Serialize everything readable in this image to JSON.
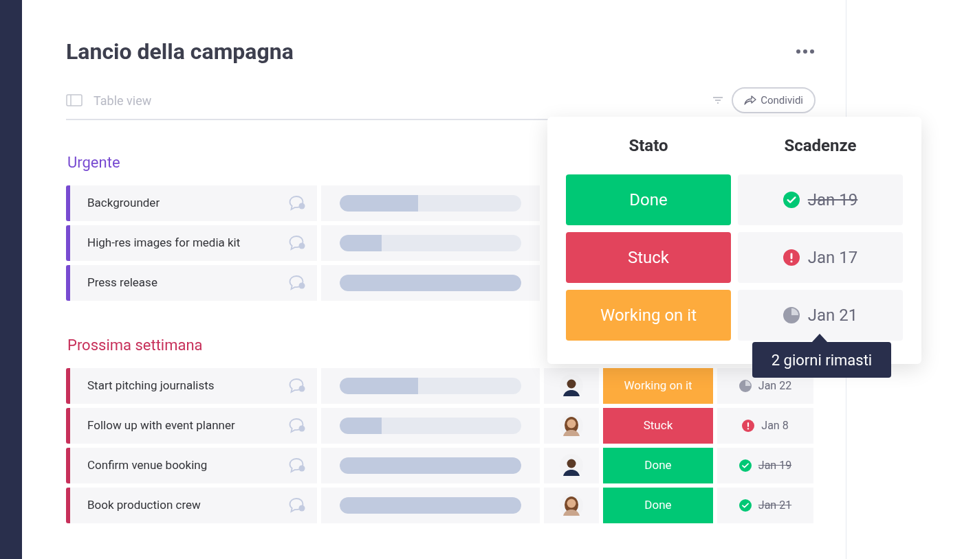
{
  "title": "Lancio della campagna",
  "view": {
    "label": "Table view"
  },
  "share_button": {
    "label": "Condividi"
  },
  "groups": [
    {
      "title": "Urgente",
      "color": "#784bd1",
      "tasks": [
        {
          "name": "Backgrounder",
          "level": 0.43
        },
        {
          "name": "High-res images for media kit",
          "level": 0.23
        },
        {
          "name": "Press release",
          "level": 1
        }
      ]
    },
    {
      "title": "Prossima settimana",
      "color": "#c7305a",
      "tasks": [
        {
          "name": "Start pitching journalists",
          "level": 0.43,
          "person": {
            "kind": "man"
          },
          "status": {
            "label": "Working on it",
            "kind": "working"
          },
          "date": {
            "label": "Jan 22",
            "kind": "working"
          }
        },
        {
          "name": "Follow up with event planner",
          "level": 0.23,
          "person": {
            "kind": "woman"
          },
          "status": {
            "label": "Stuck",
            "kind": "stuck"
          },
          "date": {
            "label": "Jan 8",
            "kind": "stuck"
          }
        },
        {
          "name": "Confirm venue booking",
          "level": 1,
          "person": {
            "kind": "man"
          },
          "status": {
            "label": "Done",
            "kind": "done"
          },
          "date": {
            "label": "Jan 19",
            "kind": "done"
          }
        },
        {
          "name": "Book production crew",
          "level": 1,
          "person": {
            "kind": "woman"
          },
          "status": {
            "label": "Done",
            "kind": "done"
          },
          "date": {
            "label": "Jan 21",
            "kind": "done"
          }
        }
      ]
    }
  ],
  "popup": {
    "columns": [
      "Stato",
      "Scadenze"
    ],
    "rows": [
      {
        "status": {
          "label": "Done",
          "kind": "done"
        },
        "date": {
          "label": "Jan 19",
          "kind": "done"
        }
      },
      {
        "status": {
          "label": "Stuck",
          "kind": "stuck"
        },
        "date": {
          "label": "Jan 17",
          "kind": "stuck"
        }
      },
      {
        "status": {
          "label": "Working on it",
          "kind": "working"
        },
        "date": {
          "label": "Jan 21",
          "kind": "working"
        }
      }
    ]
  },
  "tooltip": {
    "text": "2 giorni rimasti"
  }
}
